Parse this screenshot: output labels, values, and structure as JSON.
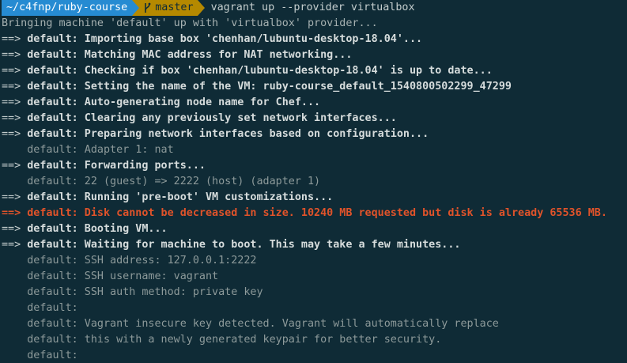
{
  "prompt": {
    "path": "~/c4fnp/ruby-course",
    "branch": "master",
    "command": "vagrant up --provider virtualbox"
  },
  "colors": {
    "background": "#0f2b36",
    "path_segment": "#268bd2",
    "branch_segment": "#b58900",
    "error": "#e0532a"
  },
  "lines": [
    {
      "type": "plain",
      "text": "Bringing machine 'default' up with 'virtualbox' provider..."
    },
    {
      "type": "step",
      "marker": "==>",
      "text": " default: Importing base box 'chenhan/lubuntu-desktop-18.04'..."
    },
    {
      "type": "step",
      "marker": "==>",
      "text": " default: Matching MAC address for NAT networking..."
    },
    {
      "type": "step",
      "marker": "==>",
      "text": " default: Checking if box 'chenhan/lubuntu-desktop-18.04' is up to date..."
    },
    {
      "type": "step",
      "marker": "==>",
      "text": " default: Setting the name of the VM: ruby-course_default_1540800502299_47299"
    },
    {
      "type": "step",
      "marker": "==>",
      "text": " default: Auto-generating node name for Chef..."
    },
    {
      "type": "step",
      "marker": "==>",
      "text": " default: Clearing any previously set network interfaces..."
    },
    {
      "type": "step",
      "marker": "==>",
      "text": " default: Preparing network interfaces based on configuration..."
    },
    {
      "type": "indent",
      "text": "    default: Adapter 1: nat"
    },
    {
      "type": "step",
      "marker": "==>",
      "text": " default: Forwarding ports..."
    },
    {
      "type": "indent",
      "text": "    default: 22 (guest) => 2222 (host) (adapter 1)"
    },
    {
      "type": "step",
      "marker": "==>",
      "text": " default: Running 'pre-boot' VM customizations..."
    },
    {
      "type": "error",
      "marker": "==>",
      "text": " default: Disk cannot be decreased in size. 10240 MB requested but disk is already 65536 MB."
    },
    {
      "type": "step",
      "marker": "==>",
      "text": " default: Booting VM..."
    },
    {
      "type": "step",
      "marker": "==>",
      "text": " default: Waiting for machine to boot. This may take a few minutes..."
    },
    {
      "type": "indent",
      "text": "    default: SSH address: 127.0.0.1:2222"
    },
    {
      "type": "indent",
      "text": "    default: SSH username: vagrant"
    },
    {
      "type": "indent",
      "text": "    default: SSH auth method: private key"
    },
    {
      "type": "indent",
      "text": "    default:"
    },
    {
      "type": "indent",
      "text": "    default: Vagrant insecure key detected. Vagrant will automatically replace"
    },
    {
      "type": "indent",
      "text": "    default: this with a newly generated keypair for better security."
    },
    {
      "type": "indent",
      "text": "    default:"
    }
  ]
}
